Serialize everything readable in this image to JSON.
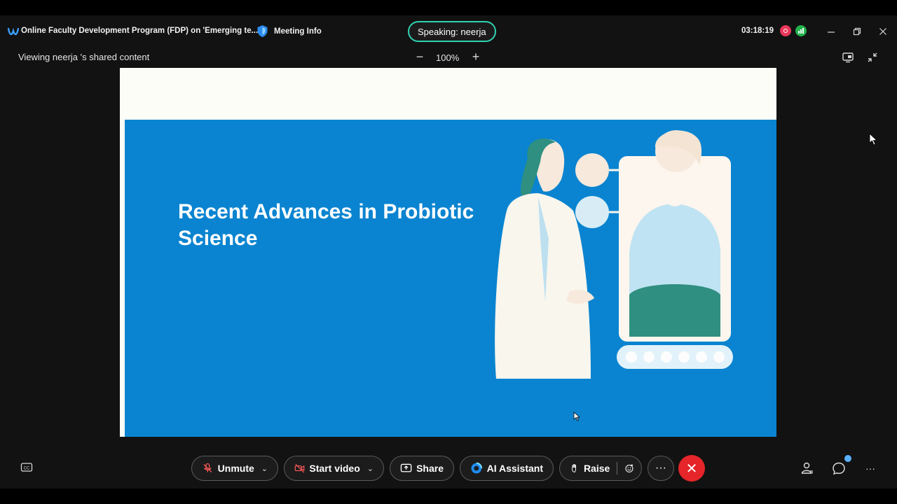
{
  "titlebar": {
    "meeting_title": "Online Faculty Development Program (FDP) on 'Emerging te...",
    "meeting_info": "Meeting Info",
    "speaking": "Speaking: neerja",
    "timer": "03:18:19",
    "icons": [
      "webex-logo-icon",
      "shield-icon",
      "recording-icon",
      "network-icon",
      "minimize-icon",
      "restore-icon",
      "close-icon"
    ]
  },
  "share_bar": {
    "viewing": "Viewing neerja 's shared content",
    "zoom_out": "−",
    "zoom_level": "100%",
    "zoom_in": "+"
  },
  "slide": {
    "title": "Recent Advances in Probiotic Science",
    "colors": {
      "background": "#0a84d0",
      "frame": "#fdfdf8"
    }
  },
  "controls": {
    "unmute": "Unmute",
    "start_video": "Start video",
    "share": "Share",
    "ai_assistant": "AI Assistant",
    "raise": "Raise",
    "more": "···",
    "leave": "✕"
  },
  "colors": {
    "speaking_border": "#2fd3b1",
    "leave": "#e5252a",
    "recording": "#e8385a",
    "network": "#22b24c"
  }
}
